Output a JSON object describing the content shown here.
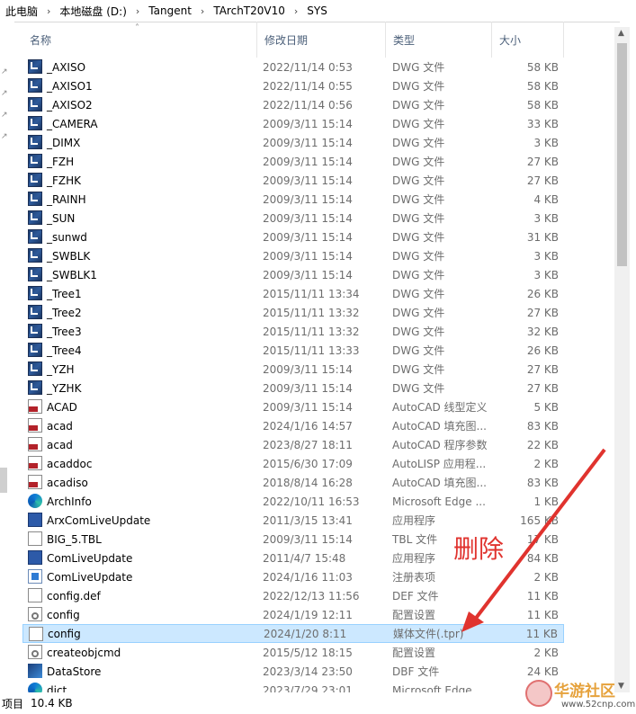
{
  "breadcrumb": [
    "此电脑",
    "本地磁盘 (D:)",
    "Tangent",
    "TArchT20V10",
    "SYS"
  ],
  "columns": {
    "name": "名称",
    "date": "修改日期",
    "type": "类型",
    "size": "大小"
  },
  "rows": [
    {
      "name": "_AXISO",
      "date": "2022/11/14 0:53",
      "type": "DWG 文件",
      "size": "58 KB",
      "icon": "dwg-file-icon"
    },
    {
      "name": "_AXISO1",
      "date": "2022/11/14 0:55",
      "type": "DWG 文件",
      "size": "58 KB",
      "icon": "dwg-file-icon"
    },
    {
      "name": "_AXISO2",
      "date": "2022/11/14 0:56",
      "type": "DWG 文件",
      "size": "58 KB",
      "icon": "dwg-file-icon"
    },
    {
      "name": "_CAMERA",
      "date": "2009/3/11 15:14",
      "type": "DWG 文件",
      "size": "33 KB",
      "icon": "dwg-file-icon"
    },
    {
      "name": "_DIMX",
      "date": "2009/3/11 15:14",
      "type": "DWG 文件",
      "size": "3 KB",
      "icon": "dwg-file-icon"
    },
    {
      "name": "_FZH",
      "date": "2009/3/11 15:14",
      "type": "DWG 文件",
      "size": "27 KB",
      "icon": "dwg-file-icon"
    },
    {
      "name": "_FZHK",
      "date": "2009/3/11 15:14",
      "type": "DWG 文件",
      "size": "27 KB",
      "icon": "dwg-file-icon"
    },
    {
      "name": "_RAINH",
      "date": "2009/3/11 15:14",
      "type": "DWG 文件",
      "size": "4 KB",
      "icon": "dwg-file-icon"
    },
    {
      "name": "_SUN",
      "date": "2009/3/11 15:14",
      "type": "DWG 文件",
      "size": "3 KB",
      "icon": "dwg-file-icon"
    },
    {
      "name": "_sunwd",
      "date": "2009/3/11 15:14",
      "type": "DWG 文件",
      "size": "31 KB",
      "icon": "dwg-file-icon"
    },
    {
      "name": "_SWBLK",
      "date": "2009/3/11 15:14",
      "type": "DWG 文件",
      "size": "3 KB",
      "icon": "dwg-file-icon"
    },
    {
      "name": "_SWBLK1",
      "date": "2009/3/11 15:14",
      "type": "DWG 文件",
      "size": "3 KB",
      "icon": "dwg-file-icon"
    },
    {
      "name": "_Tree1",
      "date": "2015/11/11 13:34",
      "type": "DWG 文件",
      "size": "26 KB",
      "icon": "dwg-file-icon"
    },
    {
      "name": "_Tree2",
      "date": "2015/11/11 13:32",
      "type": "DWG 文件",
      "size": "27 KB",
      "icon": "dwg-file-icon"
    },
    {
      "name": "_Tree3",
      "date": "2015/11/11 13:32",
      "type": "DWG 文件",
      "size": "32 KB",
      "icon": "dwg-file-icon"
    },
    {
      "name": "_Tree4",
      "date": "2015/11/11 13:33",
      "type": "DWG 文件",
      "size": "26 KB",
      "icon": "dwg-file-icon"
    },
    {
      "name": "_YZH",
      "date": "2009/3/11 15:14",
      "type": "DWG 文件",
      "size": "27 KB",
      "icon": "dwg-file-icon"
    },
    {
      "name": "_YZHK",
      "date": "2009/3/11 15:14",
      "type": "DWG 文件",
      "size": "27 KB",
      "icon": "dwg-file-icon"
    },
    {
      "name": "ACAD",
      "date": "2009/3/11 15:14",
      "type": "AutoCAD 线型定义",
      "size": "5 KB",
      "icon": "lin-file-icon"
    },
    {
      "name": "acad",
      "date": "2024/1/16 14:57",
      "type": "AutoCAD 填充图...",
      "size": "83 KB",
      "icon": "pat-file-icon"
    },
    {
      "name": "acad",
      "date": "2023/8/27 18:11",
      "type": "AutoCAD 程序参数",
      "size": "22 KB",
      "icon": "pgp-file-icon"
    },
    {
      "name": "acaddoc",
      "date": "2015/6/30 17:09",
      "type": "AutoLISP 应用程...",
      "size": "2 KB",
      "icon": "lsp-file-icon"
    },
    {
      "name": "acadiso",
      "date": "2018/8/14 16:28",
      "type": "AutoCAD 填充图...",
      "size": "83 KB",
      "icon": "pat-file-icon"
    },
    {
      "name": "ArchInfo",
      "date": "2022/10/11 16:53",
      "type": "Microsoft Edge ...",
      "size": "1 KB",
      "icon": "edge-icon"
    },
    {
      "name": "ArxComLiveUpdate",
      "date": "2011/3/15 13:41",
      "type": "应用程序",
      "size": "165 KB",
      "icon": "exe-icon"
    },
    {
      "name": "BIG_5.TBL",
      "date": "2009/3/11 15:14",
      "type": "TBL 文件",
      "size": "17 KB",
      "icon": "blank-file-icon"
    },
    {
      "name": "ComLiveUpdate",
      "date": "2011/4/7 15:48",
      "type": "应用程序",
      "size": "84 KB",
      "icon": "exe-icon"
    },
    {
      "name": "ComLiveUpdate",
      "date": "2024/1/16 11:03",
      "type": "注册表项",
      "size": "2 KB",
      "icon": "registry-icon"
    },
    {
      "name": "config.def",
      "date": "2022/12/13 11:56",
      "type": "DEF 文件",
      "size": "11 KB",
      "icon": "blank-file-icon"
    },
    {
      "name": "config",
      "date": "2024/1/19 12:11",
      "type": "配置设置",
      "size": "11 KB",
      "icon": "settings-file-icon"
    },
    {
      "name": "config",
      "date": "2024/1/20 8:11",
      "type": "媒体文件(.tpr)",
      "size": "11 KB",
      "icon": "blank-file-icon",
      "selected": true
    },
    {
      "name": "createobjcmd",
      "date": "2015/5/12 18:15",
      "type": "配置设置",
      "size": "2 KB",
      "icon": "settings-file-icon"
    },
    {
      "name": "DataStore",
      "date": "2023/3/14 23:50",
      "type": "DBF 文件",
      "size": "24 KB",
      "icon": "dbf-icon"
    },
    {
      "name": "dict",
      "date": "2023/7/29 23:01",
      "type": "Microsoft Edge ...",
      "size": "",
      "icon": "edge-icon"
    }
  ],
  "status": {
    "count_label": "项目",
    "selection_size": "10.4 KB"
  },
  "annotation": {
    "text": "删除",
    "color": "#e0332e"
  },
  "watermark": {
    "title": "华游社区",
    "url": "www.52cnp.com"
  }
}
